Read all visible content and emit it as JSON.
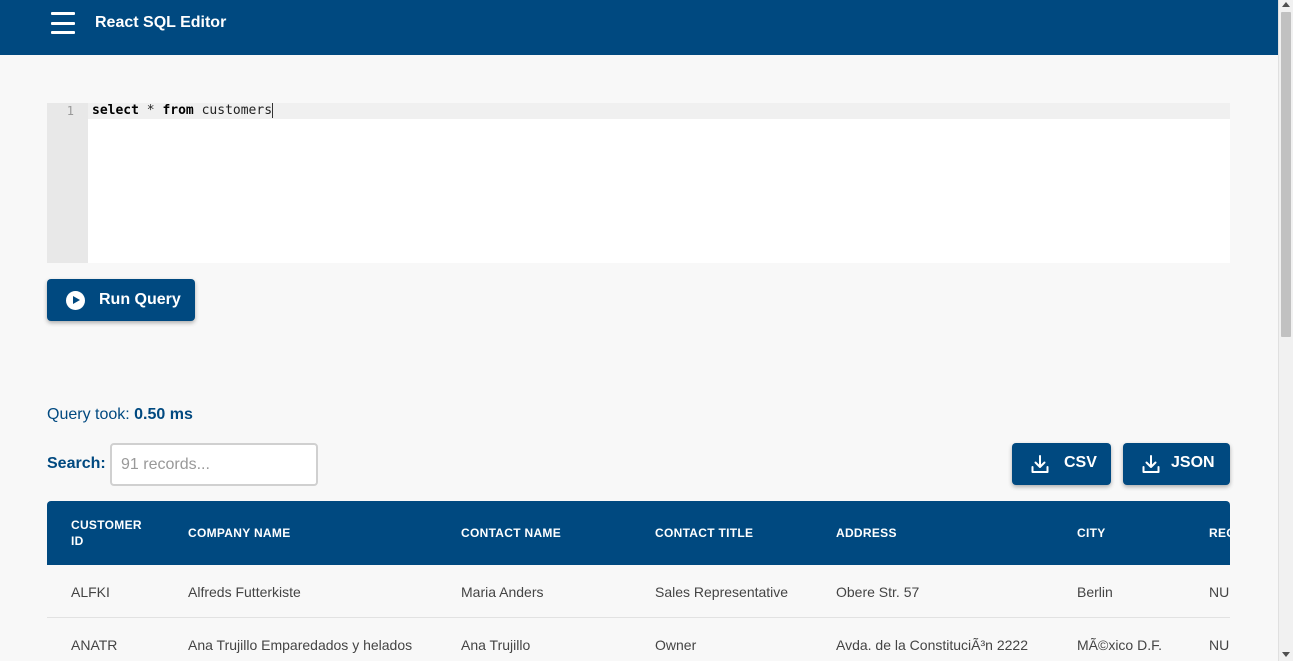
{
  "app": {
    "title": "React SQL Editor",
    "primary_color": "#004980"
  },
  "editor": {
    "line_number": "1",
    "code_tokens": {
      "kw_select": "select",
      "star": " * ",
      "kw_from": "from",
      "table": " customers"
    }
  },
  "actions": {
    "run_label": "Run Query",
    "run_icon": "play-circle-icon",
    "csv_label": "CSV",
    "json_label": "JSON",
    "download_icon": "download-icon"
  },
  "results": {
    "time_label": "Query took: ",
    "time_value": "0.50 ms",
    "search_label": "Search:",
    "search_placeholder": "91 records...",
    "columns": [
      "CUSTOMER ID",
      "COMPANY NAME",
      "CONTACT NAME",
      "CONTACT TITLE",
      "ADDRESS",
      "CITY",
      "REGION"
    ],
    "rows": [
      [
        "ALFKI",
        "Alfreds Futterkiste",
        "Maria Anders",
        "Sales Representative",
        "Obere Str. 57",
        "Berlin",
        "NULL"
      ],
      [
        "ANATR",
        "Ana Trujillo Emparedados y helados",
        "Ana Trujillo",
        "Owner",
        "Avda. de la ConstituciÃ³n 2222",
        "MÃ©xico D.F.",
        "NULL"
      ]
    ]
  }
}
